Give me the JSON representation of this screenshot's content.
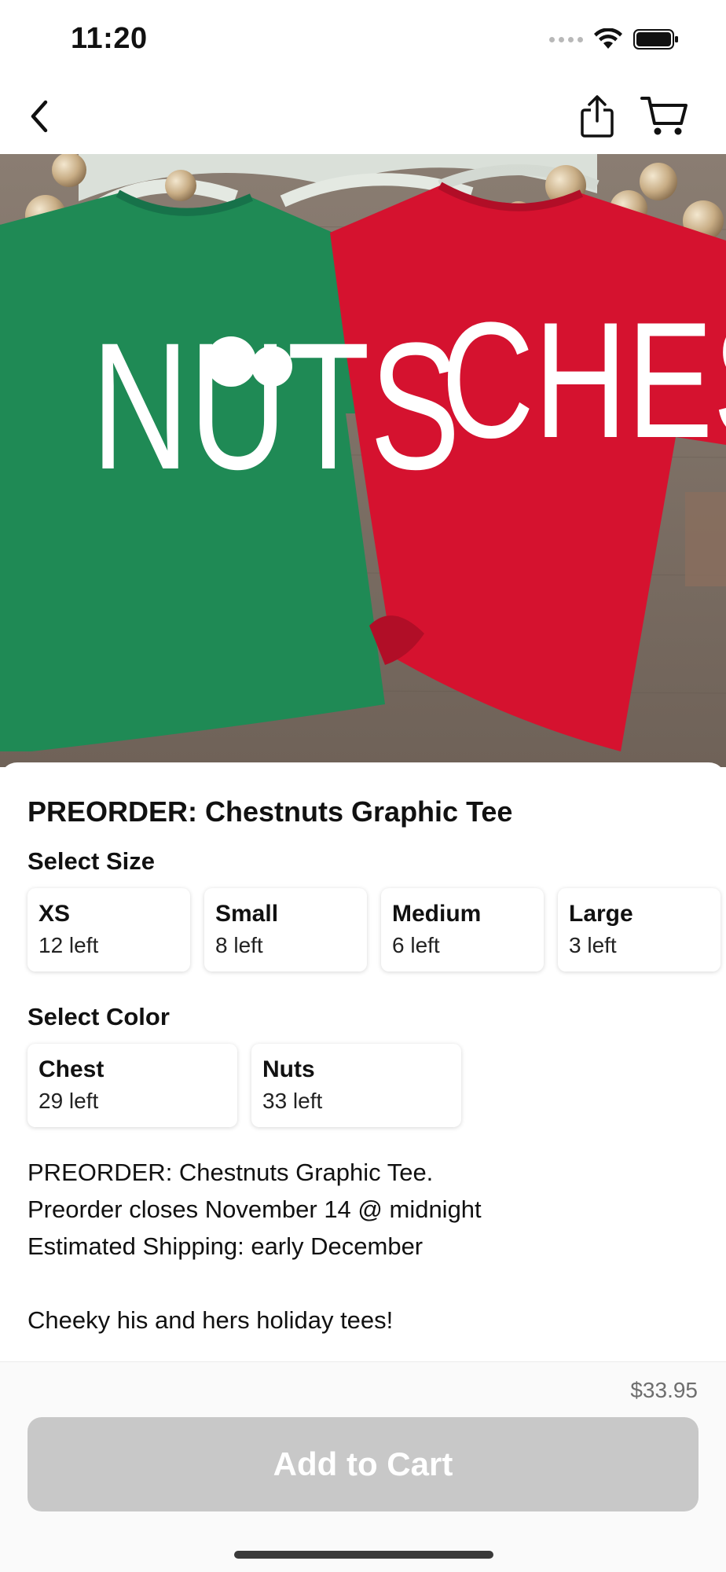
{
  "status_bar": {
    "time": "11:20"
  },
  "nav": {
    "back_icon": "chevron-left-icon",
    "share_icon": "share-icon",
    "cart_icon": "cart-icon"
  },
  "hero": {
    "image": "two christmas t-shirts green and red",
    "green_shirt_text": "NUTS",
    "red_shirt_text": "CHEST"
  },
  "product": {
    "title": "PREORDER: Chestnuts Graphic Tee"
  },
  "size": {
    "label": "Select Size",
    "options": [
      {
        "name": "XS",
        "stock": "12 left"
      },
      {
        "name": "Small",
        "stock": "8 left"
      },
      {
        "name": "Medium",
        "stock": "6 left"
      },
      {
        "name": "Large",
        "stock": "3 left"
      }
    ]
  },
  "color": {
    "label": "Select Color",
    "options": [
      {
        "name": "Chest",
        "stock": "29 left"
      },
      {
        "name": "Nuts",
        "stock": "33 left"
      }
    ]
  },
  "description": {
    "lines": [
      "PREORDER: Chestnuts Graphic Tee.",
      "Preorder closes November 14 @ midnight",
      "Estimated Shipping: early December",
      "",
      "Cheeky his and hers holiday tees!"
    ]
  },
  "footer": {
    "price": "$33.95",
    "add_to_cart_label": "Add to Cart",
    "button_color": "#c8c8c8"
  },
  "colors": {
    "green_shirt": "#1f8a55",
    "red_shirt": "#d5122f"
  }
}
